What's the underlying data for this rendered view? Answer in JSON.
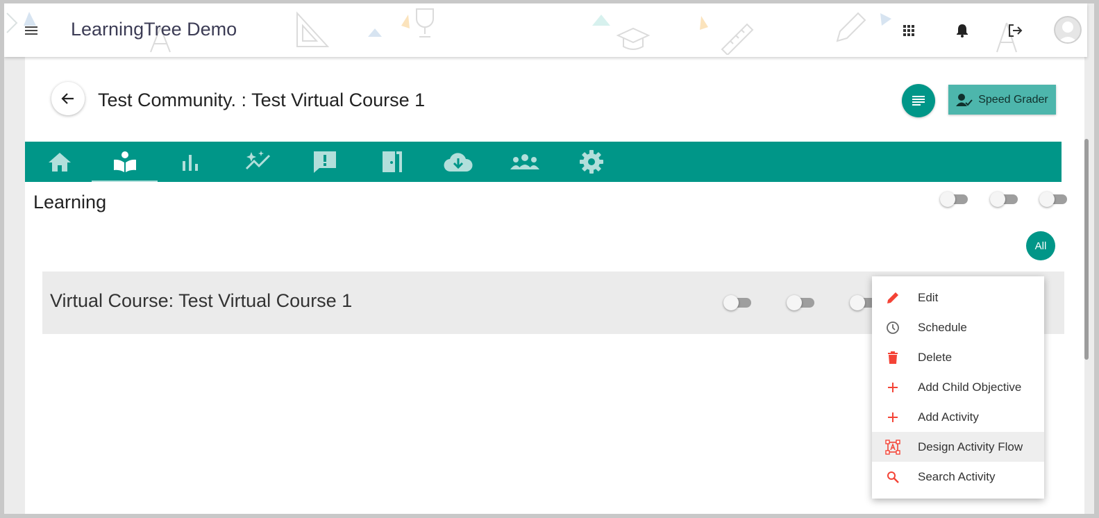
{
  "app": {
    "title": "LearningTree Demo"
  },
  "header": {
    "course_title": "Test Community. : Test Virtual Course 1",
    "speed_grader_label": "Speed Grader"
  },
  "tabs": [
    {
      "icon": "home-icon"
    },
    {
      "icon": "book-reader-icon",
      "active": true
    },
    {
      "icon": "bar-chart-icon"
    },
    {
      "icon": "sparkle-trend-icon"
    },
    {
      "icon": "feedback-icon"
    },
    {
      "icon": "exit-door-icon"
    },
    {
      "icon": "cloud-download-icon"
    },
    {
      "icon": "group-icon"
    },
    {
      "icon": "settings-gear-icon"
    }
  ],
  "section": {
    "title": "Learning",
    "all_label": "All"
  },
  "course_row": {
    "label": "Virtual Course: Test Virtual Course 1"
  },
  "context_menu": {
    "items": [
      {
        "label": "Edit",
        "icon": "pencil-icon"
      },
      {
        "label": "Schedule",
        "icon": "clock-icon"
      },
      {
        "label": "Delete",
        "icon": "trash-icon"
      },
      {
        "label": "Add Child Objective",
        "icon": "plus-icon"
      },
      {
        "label": "Add Activity",
        "icon": "plus-icon"
      },
      {
        "label": "Design Activity Flow",
        "icon": "flow-design-icon",
        "highlighted": true
      },
      {
        "label": "Search Activity",
        "icon": "search-icon"
      }
    ]
  },
  "colors": {
    "teal": "#009688",
    "teal_light": "#4db6ac",
    "accent_red": "#f44336"
  }
}
